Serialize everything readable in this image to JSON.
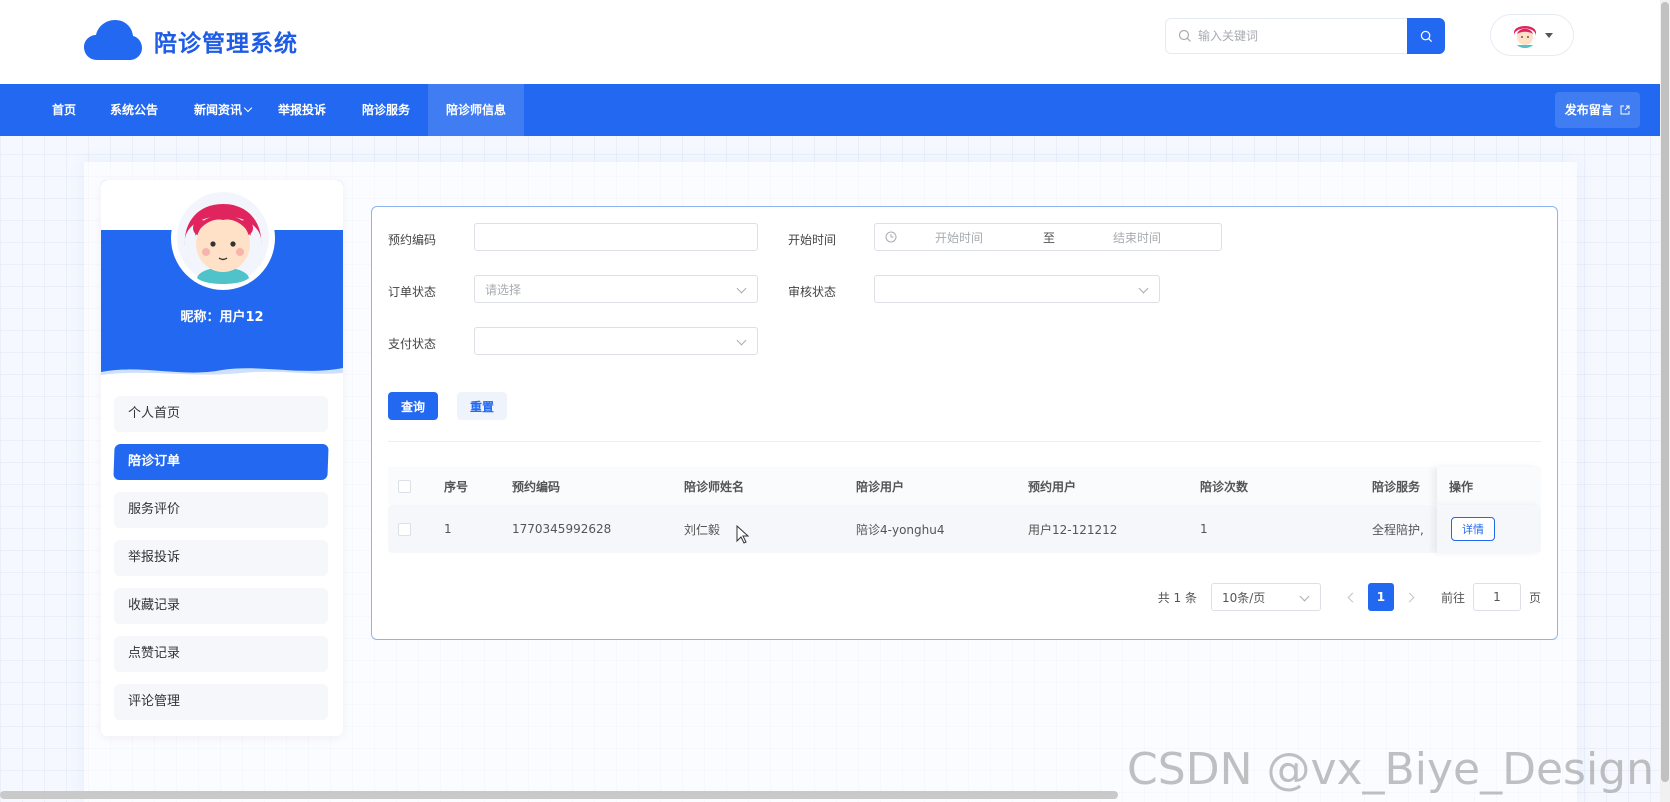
{
  "app": {
    "title": "陪诊管理系统"
  },
  "search": {
    "placeholder": "输入关键词"
  },
  "nav": {
    "items": [
      {
        "label": "首页"
      },
      {
        "label": "系统公告"
      },
      {
        "label": "新闻资讯"
      },
      {
        "label": "举报投诉"
      },
      {
        "label": "陪诊服务"
      },
      {
        "label": "陪诊师信息"
      }
    ],
    "publish": "发布留言"
  },
  "profile": {
    "nickname": "昵称：用户12"
  },
  "menu": {
    "items": [
      {
        "label": "个人首页"
      },
      {
        "label": "陪诊订单"
      },
      {
        "label": "服务评价"
      },
      {
        "label": "举报投诉"
      },
      {
        "label": "收藏记录"
      },
      {
        "label": "点赞记录"
      },
      {
        "label": "评论管理"
      }
    ]
  },
  "filters": {
    "booking_code": {
      "label": "预约编码",
      "value": ""
    },
    "start_time": {
      "label": "开始时间",
      "start_placeholder": "开始时间",
      "separator": "至",
      "end_placeholder": "结束时间"
    },
    "order_status": {
      "label": "订单状态",
      "placeholder": "请选择"
    },
    "review_status": {
      "label": "审核状态",
      "placeholder": ""
    },
    "pay_status": {
      "label": "支付状态",
      "placeholder": ""
    },
    "query": "查询",
    "reset": "重置"
  },
  "table": {
    "headers": [
      "序号",
      "预约编码",
      "陪诊师姓名",
      "陪诊用户",
      "预约用户",
      "陪诊次数",
      "陪诊服务",
      "操作"
    ],
    "rows": [
      {
        "index": "1",
        "code": "1770345992628",
        "escort_name": "刘仁毅",
        "escort_user": "陪诊4-yonghu4",
        "booking_user": "用户12-121212",
        "count": "1",
        "service": "全程陪护,",
        "action": "详情"
      }
    ]
  },
  "pagination": {
    "total": "共 1 条",
    "page_size": "10条/页",
    "current": "1",
    "goto_label": "前往",
    "goto_value": "1",
    "page_unit": "页"
  },
  "watermark": "CSDN @vx_Biye_Design",
  "colors": {
    "primary": "#2268f0",
    "border": "#dcdfe6"
  }
}
